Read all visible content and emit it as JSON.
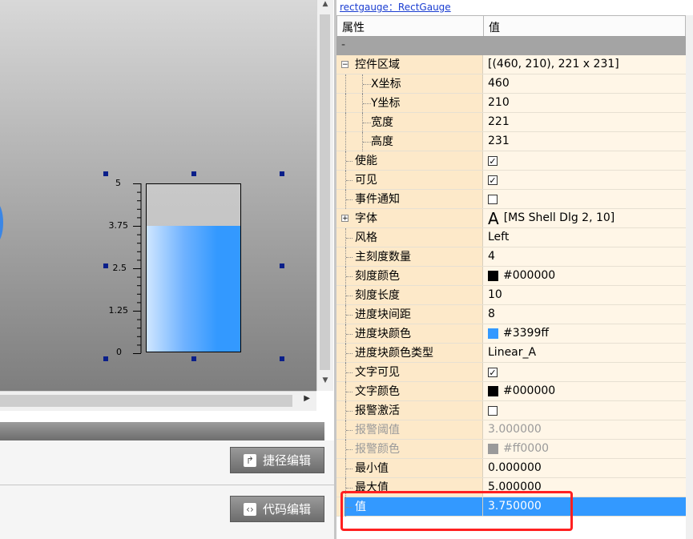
{
  "header": {
    "object_label": "rectgauge：RectGauge"
  },
  "gauge": {
    "ticks": [
      "5",
      "3.75",
      "2.5",
      "1.25",
      "0"
    ],
    "min": 0,
    "max": 5,
    "value": 3.75,
    "bar_color": "#3399ff"
  },
  "buttons": {
    "shortcut_edit": "捷径编辑",
    "code_edit": "代码编辑"
  },
  "grid": {
    "col_property": "属性",
    "col_value": "值",
    "category": "-",
    "rows": [
      {
        "label": "控件区域",
        "value": "[(460, 210), 221 x 231]"
      },
      {
        "label": "X坐标",
        "value": "460"
      },
      {
        "label": "Y坐标",
        "value": "210"
      },
      {
        "label": "宽度",
        "value": "221"
      },
      {
        "label": "高度",
        "value": "231"
      },
      {
        "label": "使能",
        "value": ""
      },
      {
        "label": "可见",
        "value": ""
      },
      {
        "label": "事件通知",
        "value": ""
      },
      {
        "label": "字体",
        "value": "[MS Shell Dlg 2, 10]",
        "glyph": "A"
      },
      {
        "label": "风格",
        "value": "Left"
      },
      {
        "label": "主刻度数量",
        "value": "4"
      },
      {
        "label": "刻度颜色",
        "value": "#000000",
        "color": "#000000"
      },
      {
        "label": "刻度长度",
        "value": "10"
      },
      {
        "label": "进度块间距",
        "value": "8"
      },
      {
        "label": "进度块颜色",
        "value": "#3399ff",
        "color": "#3399ff"
      },
      {
        "label": "进度块颜色类型",
        "value": "Linear_A"
      },
      {
        "label": "文字可见",
        "value": ""
      },
      {
        "label": "文字颜色",
        "value": "#000000",
        "color": "#000000"
      },
      {
        "label": "报警激活",
        "value": ""
      },
      {
        "label": "报警阈值",
        "value": "3.000000"
      },
      {
        "label": "报警颜色",
        "value": "#ff0000",
        "color": "#9a9a9a"
      },
      {
        "label": "最小值",
        "value": "0.000000"
      },
      {
        "label": "最大值",
        "value": "5.000000"
      },
      {
        "label": "值",
        "value": "3.750000"
      }
    ]
  }
}
